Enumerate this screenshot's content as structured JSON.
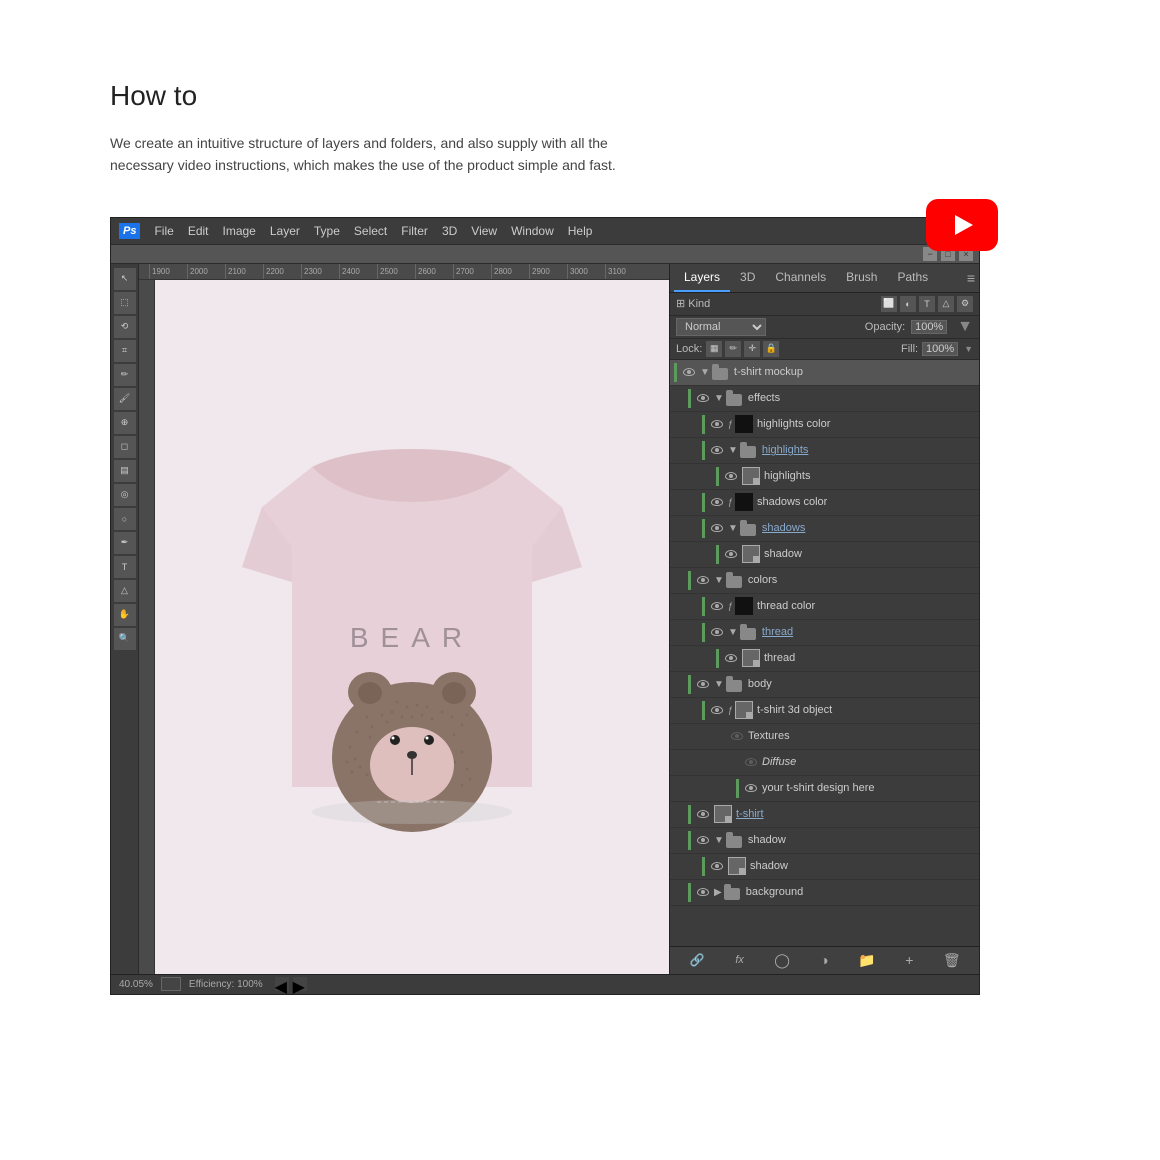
{
  "page": {
    "title": "How to",
    "description": "We create an intuitive structure of layers and folders, and also supply with all the necessary video instructions, which makes the use of the product simple and fast."
  },
  "photoshop": {
    "logo": "Ps",
    "menu_items": [
      "File",
      "Edit",
      "Image",
      "Layer",
      "Type",
      "Select",
      "Filter",
      "3D",
      "View",
      "Window",
      "Help"
    ],
    "blend_mode": "Normal",
    "opacity_label": "Opacity:",
    "opacity_value": "100%",
    "fill_label": "Fill:",
    "fill_value": "100%",
    "lock_label": "Lock:",
    "status_text": "40.05%",
    "efficiency_text": "Efficiency: 100%",
    "ruler_marks": [
      "1900",
      "2000",
      "2100",
      "2200",
      "2300",
      "2400",
      "2500",
      "2600",
      "2700",
      "2800",
      "2900",
      "3000",
      "3100"
    ]
  },
  "layers_panel": {
    "tabs": [
      "Layers",
      "3D",
      "Channels",
      "Brush",
      "Paths"
    ],
    "active_tab": "Layers",
    "kind_label": "Kind",
    "layers": [
      {
        "id": 1,
        "name": "t-shirt mockup",
        "type": "group",
        "indent": 0,
        "visible": true,
        "expanded": true
      },
      {
        "id": 2,
        "name": "effects",
        "type": "group",
        "indent": 1,
        "visible": true,
        "expanded": true
      },
      {
        "id": 3,
        "name": "highlights color",
        "type": "layer_fx",
        "indent": 2,
        "visible": true,
        "expanded": false
      },
      {
        "id": 4,
        "name": "highlights",
        "type": "group_underline",
        "indent": 2,
        "visible": true,
        "expanded": true
      },
      {
        "id": 5,
        "name": "highlights",
        "type": "smart",
        "indent": 3,
        "visible": true,
        "expanded": false
      },
      {
        "id": 6,
        "name": "shadows color",
        "type": "layer_fx",
        "indent": 2,
        "visible": true,
        "expanded": false
      },
      {
        "id": 7,
        "name": "shadows",
        "type": "group_underline",
        "indent": 2,
        "visible": true,
        "expanded": true
      },
      {
        "id": 8,
        "name": "shadow",
        "type": "smart",
        "indent": 3,
        "visible": true,
        "expanded": false
      },
      {
        "id": 9,
        "name": "colors",
        "type": "group",
        "indent": 1,
        "visible": true,
        "expanded": true
      },
      {
        "id": 10,
        "name": "thread color",
        "type": "layer_fx",
        "indent": 2,
        "visible": true,
        "expanded": false
      },
      {
        "id": 11,
        "name": "thread",
        "type": "group_underline",
        "indent": 2,
        "visible": true,
        "expanded": true
      },
      {
        "id": 12,
        "name": "thread",
        "type": "smart",
        "indent": 3,
        "visible": true,
        "expanded": false
      },
      {
        "id": 13,
        "name": "body",
        "type": "group",
        "indent": 1,
        "visible": true,
        "expanded": true
      },
      {
        "id": 14,
        "name": "t-shirt 3d object",
        "type": "smart_3d",
        "indent": 2,
        "visible": true,
        "expanded": true
      },
      {
        "id": 15,
        "name": "Textures",
        "type": "sub",
        "indent": 3,
        "visible": false,
        "expanded": true
      },
      {
        "id": 16,
        "name": "Diffuse",
        "type": "sub_italic",
        "indent": 4,
        "visible": false,
        "expanded": true
      },
      {
        "id": 17,
        "name": "your t-shirt design here",
        "type": "sub_vis",
        "indent": 4,
        "visible": true,
        "expanded": false
      },
      {
        "id": 18,
        "name": "t-shirt",
        "type": "smart_underline",
        "indent": 1,
        "visible": true,
        "expanded": false
      },
      {
        "id": 19,
        "name": "shadow",
        "type": "group",
        "indent": 1,
        "visible": true,
        "expanded": true
      },
      {
        "id": 20,
        "name": "shadow",
        "type": "smart",
        "indent": 2,
        "visible": true,
        "expanded": false
      },
      {
        "id": 21,
        "name": "background",
        "type": "group_closed",
        "indent": 1,
        "visible": true,
        "expanded": false
      }
    ],
    "bottom_buttons": [
      "link",
      "fx",
      "mask",
      "adjustment",
      "group",
      "layer",
      "delete"
    ]
  },
  "tshirt": {
    "text": "BEAR"
  }
}
